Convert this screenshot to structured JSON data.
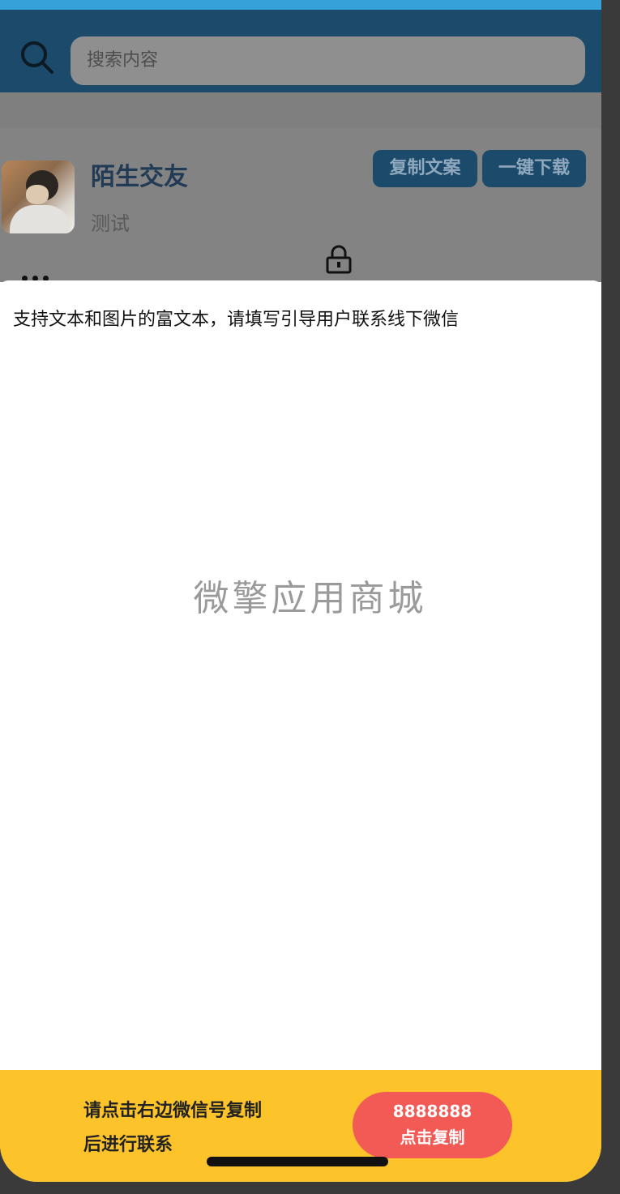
{
  "search": {
    "placeholder": "搜索内容"
  },
  "post": {
    "title": "陌生交友",
    "subtitle": "测试",
    "copy_text_label": "复制文案",
    "download_label": "一键下载"
  },
  "sheet": {
    "content": "支持文本和图片的富文本，请填写引导用户联系线下微信",
    "watermark": "微擎应用商城"
  },
  "footer": {
    "instruction_line1": "请点击右边微信号复制",
    "instruction_line2": "后进行联系",
    "wechat_id": "8888888",
    "copy_label": "点击复制"
  },
  "colors": {
    "header_bg": "#1b4a6a",
    "status_bar": "#36a0d8",
    "footer_bg": "#fcc42a",
    "copy_button": "#f25a55"
  },
  "icons": [
    "search-icon",
    "more-icon",
    "lock-icon"
  ]
}
